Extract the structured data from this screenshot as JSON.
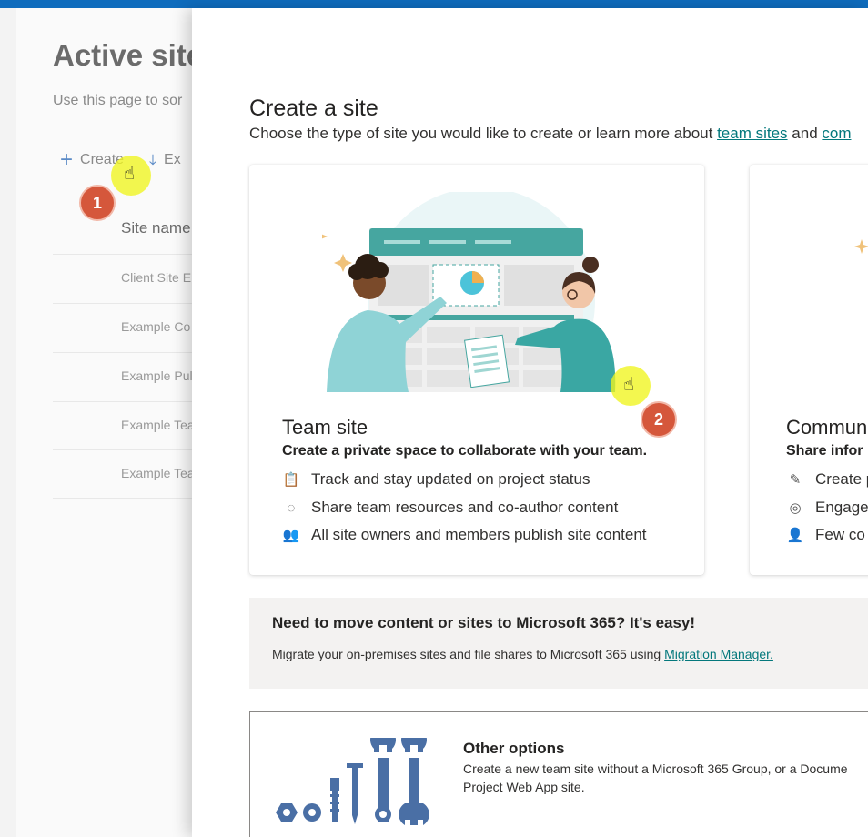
{
  "background_page": {
    "title": "Active site",
    "description": "Use this page to sor",
    "create_label": "Create",
    "export_label": "Ex",
    "column_site_name": "Site name",
    "rows": [
      "Client Site E",
      "Example Co",
      "Example Pul",
      "Example Tea",
      "Example Tea"
    ]
  },
  "annotations": {
    "step1": "1",
    "step2": "2"
  },
  "panel": {
    "title": "Create a site",
    "subtitle_prefix": "Choose the type of site you would like to create or learn more about ",
    "link_team_sites": "team sites",
    "subtitle_and": " and ",
    "link_com": "com"
  },
  "team_card": {
    "title": "Team site",
    "subtitle": "Create a private space to collaborate with your team.",
    "features": [
      "Track and stay updated on project status",
      "Share team resources and co-author content",
      "All site owners and members publish site content"
    ]
  },
  "comm_card": {
    "title": "Commun",
    "subtitle": "Share infor",
    "features": [
      "Create p",
      "Engage",
      "Few co"
    ]
  },
  "migration": {
    "title": "Need to move content or sites to Microsoft 365? It's easy!",
    "desc_prefix": "Migrate your on-premises sites and file shares to Microsoft 365 using ",
    "link": "Migration Manager."
  },
  "other_options": {
    "title": "Other options",
    "desc": "Create a new team site without a Microsoft 365 Group, or a Docume Project Web App site."
  },
  "colors": {
    "accent_teal": "#03787c",
    "topbar": "#0f6cbd",
    "badge": "#d5573b",
    "cursor_highlight": "#f0f51e",
    "tools_blue": "#4a6fa5"
  }
}
